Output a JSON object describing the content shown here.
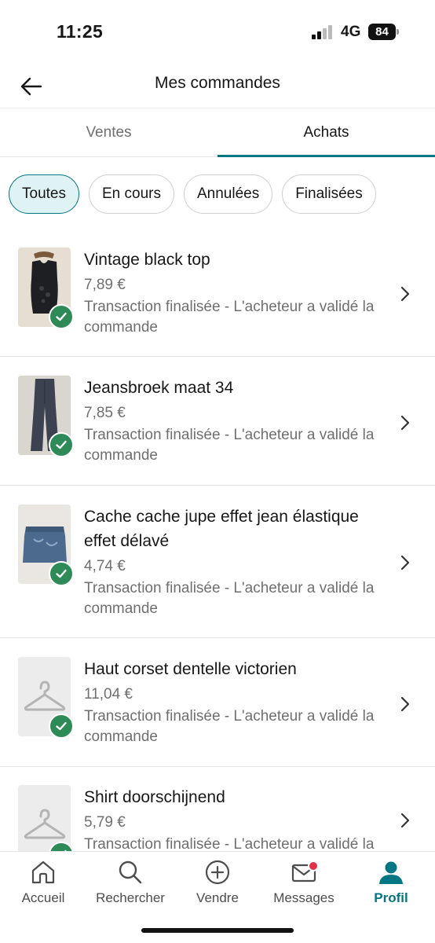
{
  "status": {
    "time": "11:25",
    "network": "4G",
    "battery": "84"
  },
  "header": {
    "title": "Mes commandes"
  },
  "tabs": [
    {
      "label": "Ventes",
      "active": false
    },
    {
      "label": "Achats",
      "active": true
    }
  ],
  "filters": [
    {
      "label": "Toutes",
      "active": true
    },
    {
      "label": "En cours",
      "active": false
    },
    {
      "label": "Annulées",
      "active": false
    },
    {
      "label": "Finalisées",
      "active": false
    }
  ],
  "orders": [
    {
      "title": "Vintage black top",
      "price": "7,89 €",
      "status": "Transaction finalisée - L'acheteur a validé la commande",
      "thumbnail": "black-top-photo",
      "completed": true
    },
    {
      "title": "Jeansbroek maat 34",
      "price": "7,85 €",
      "status": "Transaction finalisée - L'acheteur a validé la commande",
      "thumbnail": "jeans-photo",
      "completed": true
    },
    {
      "title": "Cache cache jupe effet jean élastique effet délavé",
      "price": "4,74 €",
      "status": "Transaction finalisée - L'acheteur a validé la commande",
      "thumbnail": "denim-skirt-photo",
      "completed": true
    },
    {
      "title": "Haut corset dentelle victorien",
      "price": "11,04 €",
      "status": "Transaction finalisée - L'acheteur a validé la commande",
      "thumbnail": "hanger-placeholder-icon",
      "completed": true
    },
    {
      "title": "Shirt doorschijnend",
      "price": "5,79 €",
      "status": "Transaction finalisée - L'acheteur a validé la commande",
      "thumbnail": "hanger-placeholder-icon",
      "completed": true
    }
  ],
  "bottom_nav": [
    {
      "label": "Accueil",
      "icon": "home-icon",
      "active": false
    },
    {
      "label": "Rechercher",
      "icon": "search-icon",
      "active": false
    },
    {
      "label": "Vendre",
      "icon": "plus-circle-icon",
      "active": false
    },
    {
      "label": "Messages",
      "icon": "mail-icon",
      "active": false,
      "notification": true
    },
    {
      "label": "Profil",
      "icon": "profile-icon",
      "active": true
    }
  ],
  "colors": {
    "accent": "#007782",
    "success": "#2e8b57",
    "notification": "#e0324b",
    "chip_active_bg": "#e0f3f4"
  }
}
